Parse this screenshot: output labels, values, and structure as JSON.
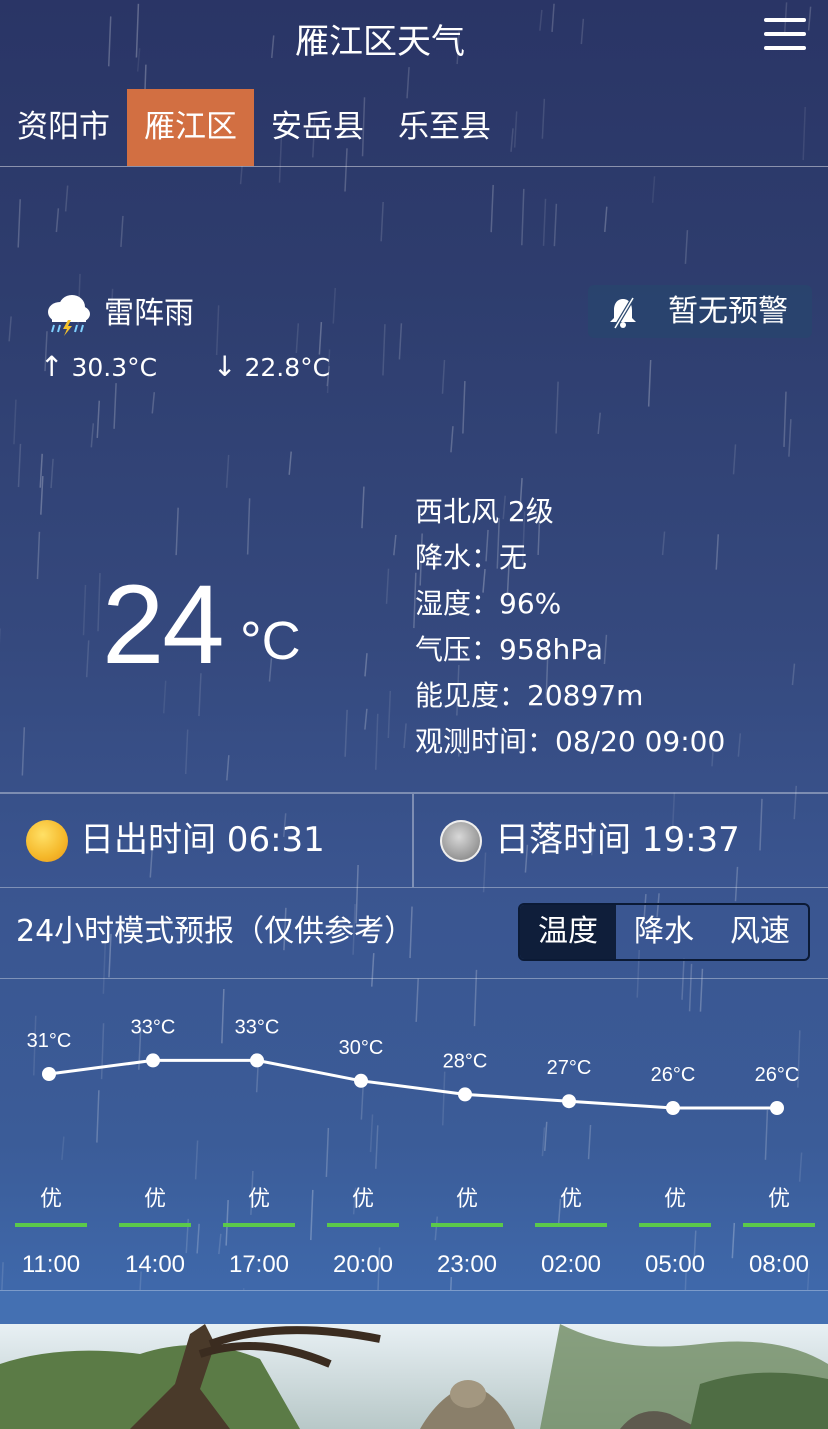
{
  "header": {
    "title": "雁江区天气",
    "menu_icon": "hamburger-menu-icon"
  },
  "district_tabs": [
    {
      "label": "资阳市",
      "active": false
    },
    {
      "label": "雁江区",
      "active": true
    },
    {
      "label": "安岳县",
      "active": false
    },
    {
      "label": "乐至县",
      "active": false
    }
  ],
  "current": {
    "condition": "雷阵雨",
    "condition_icon": "thunderstorm-cloud-icon",
    "high": "30.3°C",
    "low": "22.8°C",
    "temperature": "24",
    "unit": "°C"
  },
  "warning": {
    "label": "暂无预警",
    "icon": "bell-off-icon"
  },
  "details": {
    "wind": "西北风 2级",
    "precipitation": "降水：无",
    "humidity": "湿度：96%",
    "pressure": "气压：958hPa",
    "visibility": "能见度：20897m",
    "observed": "观测时间：08/20 09:00"
  },
  "sun": {
    "sunrise": "日出时间 06:31",
    "sunset": "日落时间 19:37"
  },
  "forecast": {
    "title": "24小时模式预报（仅供参考）",
    "modes": [
      {
        "label": "温度",
        "active": true
      },
      {
        "label": "降水",
        "active": false
      },
      {
        "label": "风速",
        "active": false
      }
    ]
  },
  "chart_data": {
    "type": "line",
    "x": [
      "11:00",
      "14:00",
      "17:00",
      "20:00",
      "23:00",
      "02:00",
      "05:00",
      "08:00"
    ],
    "series": [
      {
        "values": [
          31,
          33,
          33,
          30,
          28,
          27,
          26,
          26
        ]
      }
    ],
    "point_labels": [
      "31°C",
      "33°C",
      "33°C",
      "30°C",
      "28°C",
      "27°C",
      "26°C",
      "26°C"
    ],
    "air_quality": [
      "优",
      "优",
      "优",
      "优",
      "优",
      "优",
      "优",
      "优"
    ],
    "air_quality_color": "#5bc94a",
    "line_color": "#ffffff"
  },
  "colors": {
    "active_tab": "#d26f42",
    "sun": "#f5b82a"
  }
}
